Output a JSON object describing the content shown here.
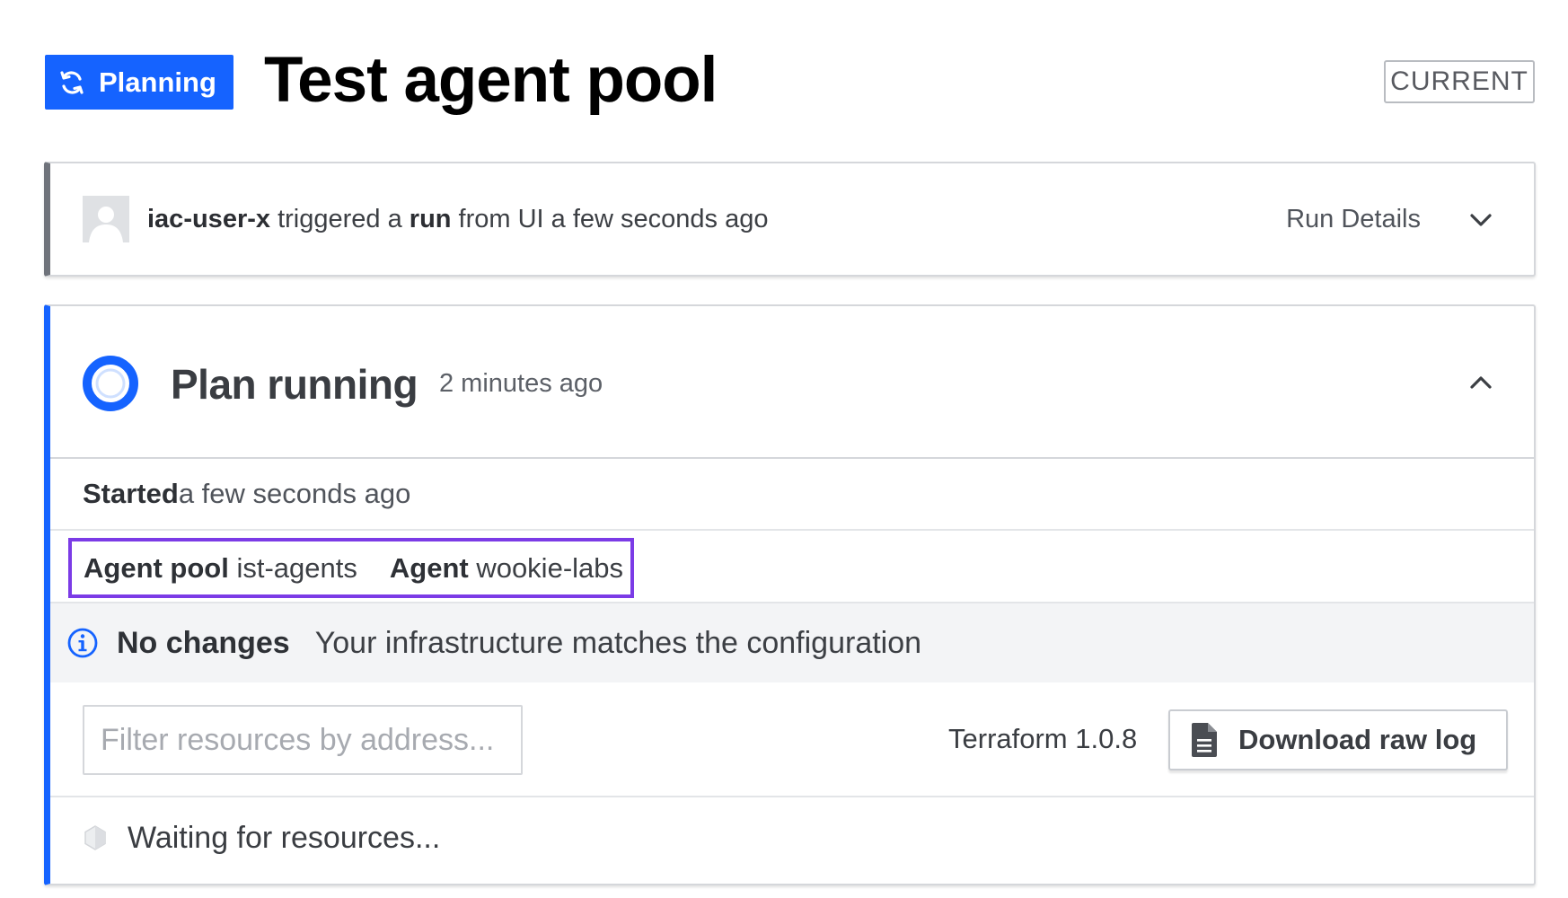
{
  "header": {
    "status_label": "Planning",
    "status_icon": "sync-icon",
    "title": "Test agent pool",
    "current_badge": "CURRENT"
  },
  "trigger": {
    "user": "iac-user-x",
    "text_triggered": " triggered a ",
    "run_word": "run",
    "text_rest": " from UI a few seconds ago",
    "run_details_label": "Run Details"
  },
  "plan": {
    "title": "Plan running",
    "time": "2 minutes ago",
    "started_label": "Started",
    "started_value": " a few seconds ago",
    "agent_pool_label": "Agent pool",
    "agent_pool_value": " ist-agents",
    "agent_label": "Agent",
    "agent_value": " wookie-labs",
    "no_changes_title": "No changes",
    "no_changes_text": "Your infrastructure matches the configuration",
    "filter_placeholder": "Filter resources by address...",
    "terraform_version": "Terraform 1.0.8",
    "download_label": "Download raw log",
    "waiting_text": "Waiting for resources..."
  },
  "colors": {
    "accent": "#1563ff",
    "highlight_box": "#7b3be6"
  }
}
